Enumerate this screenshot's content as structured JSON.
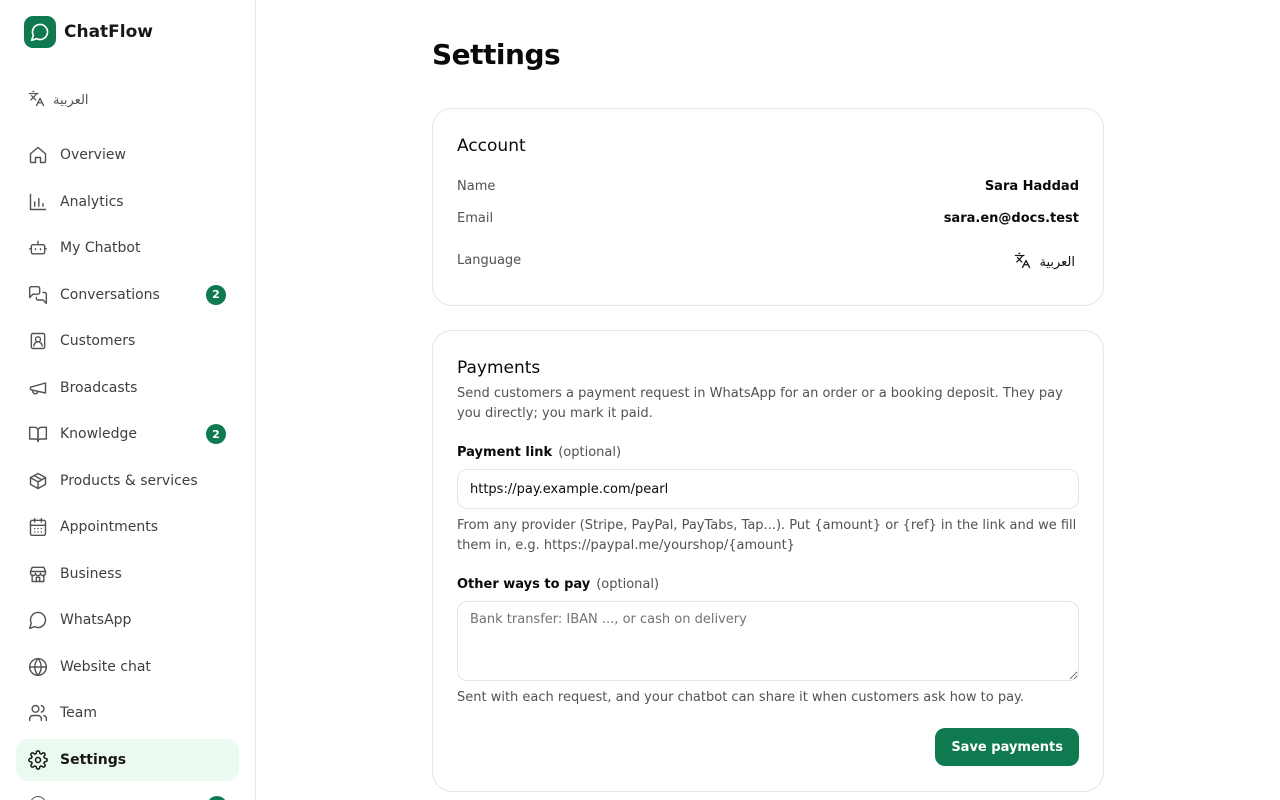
{
  "app": {
    "name": "ChatFlow",
    "accent_color": "#0f7a4f"
  },
  "sidebar": {
    "language_switch": "العربية",
    "items": [
      {
        "label": "Overview",
        "icon": "home-icon"
      },
      {
        "label": "Analytics",
        "icon": "bar-chart-icon"
      },
      {
        "label": "My Chatbot",
        "icon": "bot-icon"
      },
      {
        "label": "Conversations",
        "icon": "messages-icon",
        "badge": "2"
      },
      {
        "label": "Customers",
        "icon": "contact-icon"
      },
      {
        "label": "Broadcasts",
        "icon": "megaphone-icon"
      },
      {
        "label": "Knowledge",
        "icon": "book-icon",
        "badge": "2"
      },
      {
        "label": "Products & services",
        "icon": "package-icon"
      },
      {
        "label": "Appointments",
        "icon": "calendar-icon"
      },
      {
        "label": "Business",
        "icon": "store-icon"
      },
      {
        "label": "WhatsApp",
        "icon": "chat-bubble-icon"
      },
      {
        "label": "Website chat",
        "icon": "globe-icon"
      },
      {
        "label": "Team",
        "icon": "users-icon"
      },
      {
        "label": "Settings",
        "icon": "gear-icon",
        "active": true
      }
    ]
  },
  "main": {
    "title": "Settings",
    "account": {
      "title": "Account",
      "name_label": "Name",
      "name_value": "Sara Haddad",
      "email_label": "Email",
      "email_value": "sara.en@docs.test",
      "language_label": "Language",
      "language_value": "العربية"
    },
    "payments": {
      "title": "Payments",
      "description": "Send customers a payment request in WhatsApp for an order or a booking deposit. They pay you directly; you mark it paid.",
      "payment_link_label": "Payment link",
      "payment_link_optional": "(optional)",
      "payment_link_value": "https://pay.example.com/pearl",
      "payment_link_help": "From any provider (Stripe, PayPal, PayTabs, Tap...). Put {amount} or {ref} in the link and we fill them in, e.g. https://paypal.me/yourshop/{amount}",
      "other_ways_label": "Other ways to pay",
      "other_ways_optional": "(optional)",
      "other_ways_placeholder": "Bank transfer: IBAN ..., or cash on delivery",
      "other_ways_help": "Sent with each request, and your chatbot can share it when customers ask how to pay.",
      "save_label": "Save payments"
    }
  }
}
